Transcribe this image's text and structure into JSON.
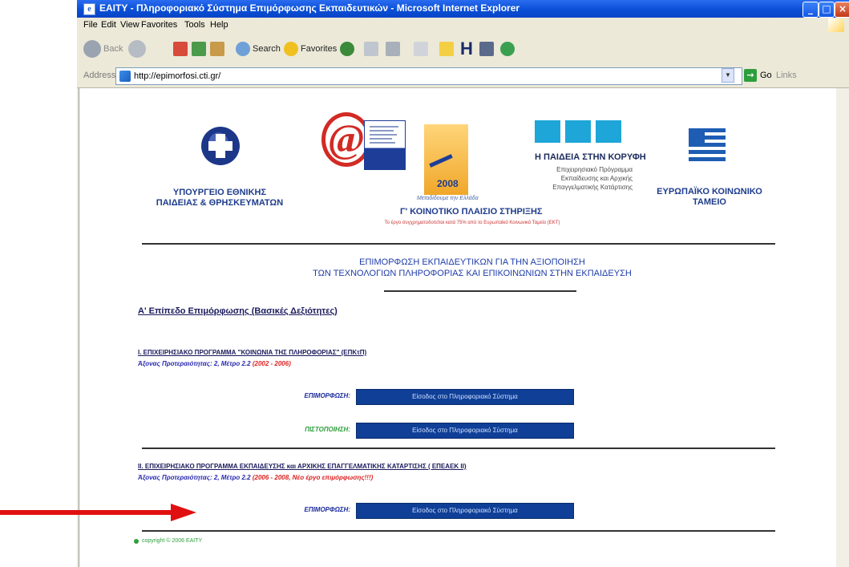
{
  "window": {
    "title": "ΕΑΙΤΥ - Πληροφοριακό Σύστημα Επιμόρφωσης Εκπαιδευτικών - Microsoft Internet Explorer"
  },
  "menu": [
    "File",
    "Edit",
    "View",
    "Favorites",
    "Tools",
    "Help"
  ],
  "toolbar": {
    "back": "Back",
    "search": "Search",
    "favorites": "Favorites"
  },
  "address": {
    "label": "Address",
    "url": "http://epimorfosi.cti.gr/",
    "go": "Go",
    "links": "Links"
  },
  "header": {
    "ministry": [
      "ΥΠΟΥΡΓΕΙΟ ΕΘΝΙΚΗΣ",
      "ΠΑΙΔΕΙΑΣ & ΘΡΗΣΚΕΥΜΑΤΩΝ"
    ],
    "hellas_year": "2008",
    "paideia_title": "Η ΠΑΙΔΕΙΑ ΣΤΗΝ ΚΟΡΥΦΗ",
    "paideia_sub": [
      "Επιχειρησιακό Πρόγραμμα",
      "Εκπαίδευσης και Αρχικής",
      "Επαγγελματικής Κατάρτισης"
    ],
    "kps_title": "Γ' ΚΟΙΝΟΤΙΚΟ ΠΛΑΙΣΙΟ ΣΤΗΡΙΞΗΣ",
    "kps_sub": "Το έργο συγχρηματοδοτείται κατά 75% από το Ευρωπαϊκό Κοινωνικό Ταμείο (ΕΚΤ)",
    "eu": [
      "ΕΥΡΩΠΑΪΚΟ ΚΟΙΝΩΝΙΚΟ",
      "ΤΑΜΕΙΟ"
    ]
  },
  "main_title": [
    "ΕΠΙΜΟΡΦΩΣΗ ΕΚΠΑΙΔΕΥΤΙΚΩΝ ΓΙΑ ΤΗΝ ΑΞΙΟΠΟΙΗΣΗ",
    "ΤΩΝ ΤΕΧΝΟΛΟΓΙΩΝ ΠΛΗΡΟΦΟΡΙΑΣ ΚΑΙ ΕΠΙΚΟΙΝΩΝΙΩΝ ΣΤΗΝ ΕΚΠΑΙΔΕΥΣΗ"
  ],
  "level_heading": "Α' Επίπεδο Επιμόρφωσης (Βασικές Δεξιότητες)",
  "program1": {
    "title": "I. ΕΠΙΧΕΙΡΗΣΙΑΚΟ ΠΡΟΓΡΑΜΜΑ \"ΚΟΙΝΩΝΙΑ ΤΗΣ ΠΛΗΡΟΦΟΡΙΑΣ\" (ΕΠΚτΠ)",
    "axis": "Άξονας Προτεραιότητας: 2, Μέτρο 2.2 ",
    "years": "(2002 - 2006)",
    "rows": [
      {
        "label": "ΕΠΙΜΟΡΦΩΣΗ:",
        "button": "Είσοδος στο Πληροφοριακό Σύστημα",
        "color": "#1a2a9c"
      },
      {
        "label": "ΠΙΣΤΟΠΟΙΗΣΗ:",
        "button": "Είσοδος στο Πληροφοριακό Σύστημα",
        "color": "#2e9e3c"
      }
    ]
  },
  "program2": {
    "title": "II. ΕΠΙΧΕΙΡΗΣΙΑΚΟ ΠΡΟΓΡΑΜΜΑ ΕΚΠΑΙΔΕΥΣΗΣ και ΑΡΧΙΚΗΣ ΕΠΑΓΓΕΛΜΑΤΙΚΗΣ ΚΑΤΑΡΤΙΣΗΣ ( ΕΠΕΑΕΚ ΙΙ)",
    "axis": "Άξονας Προτεραιότητας: 2, Μέτρο 2.2 ",
    "years": "(2006 - 2008, Νέο έργο επιμόρφωσης!!!)",
    "rows": [
      {
        "label": "ΕΠΙΜΟΡΦΩΣΗ:",
        "button": "Είσοδος στο Πληροφοριακό Σύστημα",
        "color": "#1a2a9c"
      }
    ]
  },
  "footer": {
    "copyright": "copyright © 2006 ΕΑΙΤΥ"
  },
  "colors": {
    "arrow": "#e11010",
    "entry_button": "#0f3f96",
    "title_blue": "#1e3ca8"
  }
}
